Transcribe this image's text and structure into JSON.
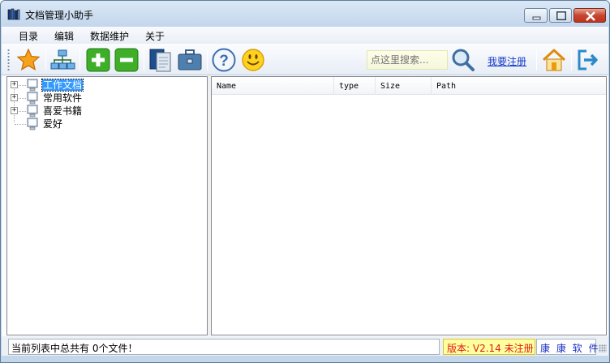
{
  "window": {
    "title": "文档管理小助手",
    "icon": "books-icon"
  },
  "menu": [
    "目录",
    "编辑",
    "数据维护",
    "关于"
  ],
  "toolbar": {
    "buttons": [
      "star-icon",
      "network-icon",
      "plus-icon",
      "minus-icon",
      "copy-icon",
      "briefcase-icon",
      "help-icon",
      "smiley-icon",
      "search-icon",
      "home-icon",
      "exit-icon"
    ],
    "search_placeholder": "点这里搜索...",
    "register_label": "我要注册"
  },
  "tree": {
    "items": [
      {
        "label": "工作文档",
        "selected": true,
        "expandable": true
      },
      {
        "label": "常用软件",
        "selected": false,
        "expandable": true
      },
      {
        "label": "喜爱书籍",
        "selected": false,
        "expandable": true
      },
      {
        "label": "爱好",
        "selected": false,
        "expandable": false
      }
    ]
  },
  "list": {
    "columns": [
      "Name",
      "type",
      "Size",
      "Path"
    ],
    "rows": []
  },
  "status": {
    "message": "当前列表中总共有 0个文件！",
    "version": "版本: V2.14 未注册",
    "company": "康 康 软 件"
  },
  "colors": {
    "selection": "#3399ff",
    "accent_green": "#3fae29",
    "link": "#1238c9",
    "version_text": "#e11a1a"
  }
}
